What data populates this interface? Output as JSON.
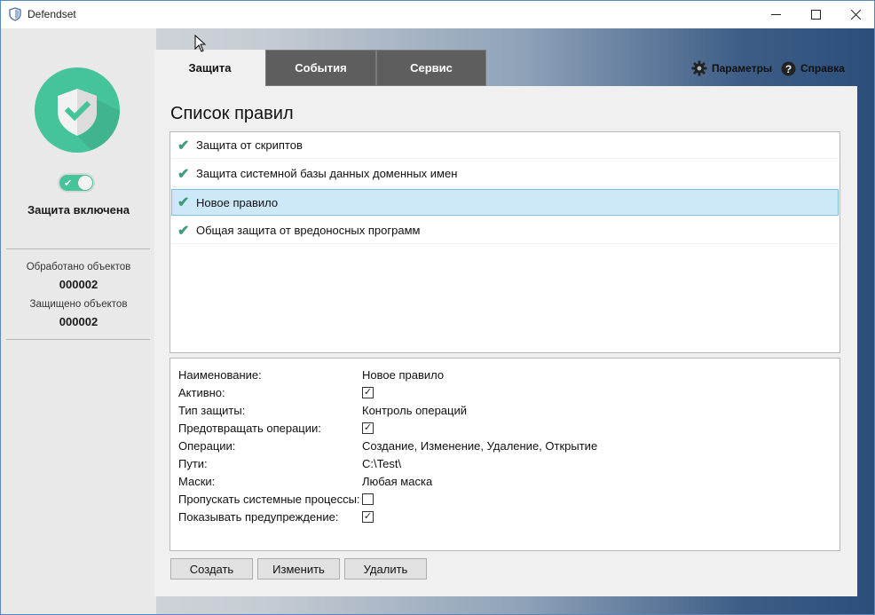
{
  "window": {
    "title": "Defendset",
    "icon": "shield-icon"
  },
  "sidebar": {
    "status": "Защита включена",
    "stats": [
      {
        "label": "Обработано объектов",
        "value": "000002"
      },
      {
        "label": "Защищено объектов",
        "value": "000002"
      }
    ]
  },
  "tabs": [
    {
      "label": "Защита",
      "active": true
    },
    {
      "label": "События",
      "active": false
    },
    {
      "label": "Сервис",
      "active": false
    }
  ],
  "toplinks": {
    "settings": {
      "label": "Параметры",
      "icon": "gear-icon"
    },
    "help": {
      "label": "Справка",
      "icon": "help-icon"
    }
  },
  "panel": {
    "title": "Список правил",
    "rules": [
      {
        "label": "Защита от скриптов",
        "selected": false
      },
      {
        "label": "Защита системной базы данных доменных имен",
        "selected": false
      },
      {
        "label": "Новое правило",
        "selected": true
      },
      {
        "label": "Общая защита от вредоносных программ",
        "selected": false
      }
    ],
    "details": [
      {
        "label": "Наименование:",
        "value": "Новое правило"
      },
      {
        "label": "Активно:",
        "checkbox": true,
        "checked": true
      },
      {
        "label": "Тип защиты:",
        "value": "Контроль операций"
      },
      {
        "label": "Предотвращать операции:",
        "checkbox": true,
        "checked": true
      },
      {
        "label": "Операции:",
        "value": "Создание, Изменение, Удаление, Открытие"
      },
      {
        "label": "Пути:",
        "value": "C:\\Test\\"
      },
      {
        "label": "Маски:",
        "value": "Любая маска"
      },
      {
        "label": "Пропускать системные процессы:",
        "checkbox": true,
        "checked": false
      },
      {
        "label": "Показывать предупреждение:",
        "checkbox": true,
        "checked": true
      }
    ],
    "buttons": {
      "create": "Создать",
      "edit": "Изменить",
      "delete": "Удалить"
    }
  },
  "colors": {
    "accent": "#45c39a",
    "selection": "#cce8f9",
    "tab_inactive": "#5e5e5e"
  }
}
